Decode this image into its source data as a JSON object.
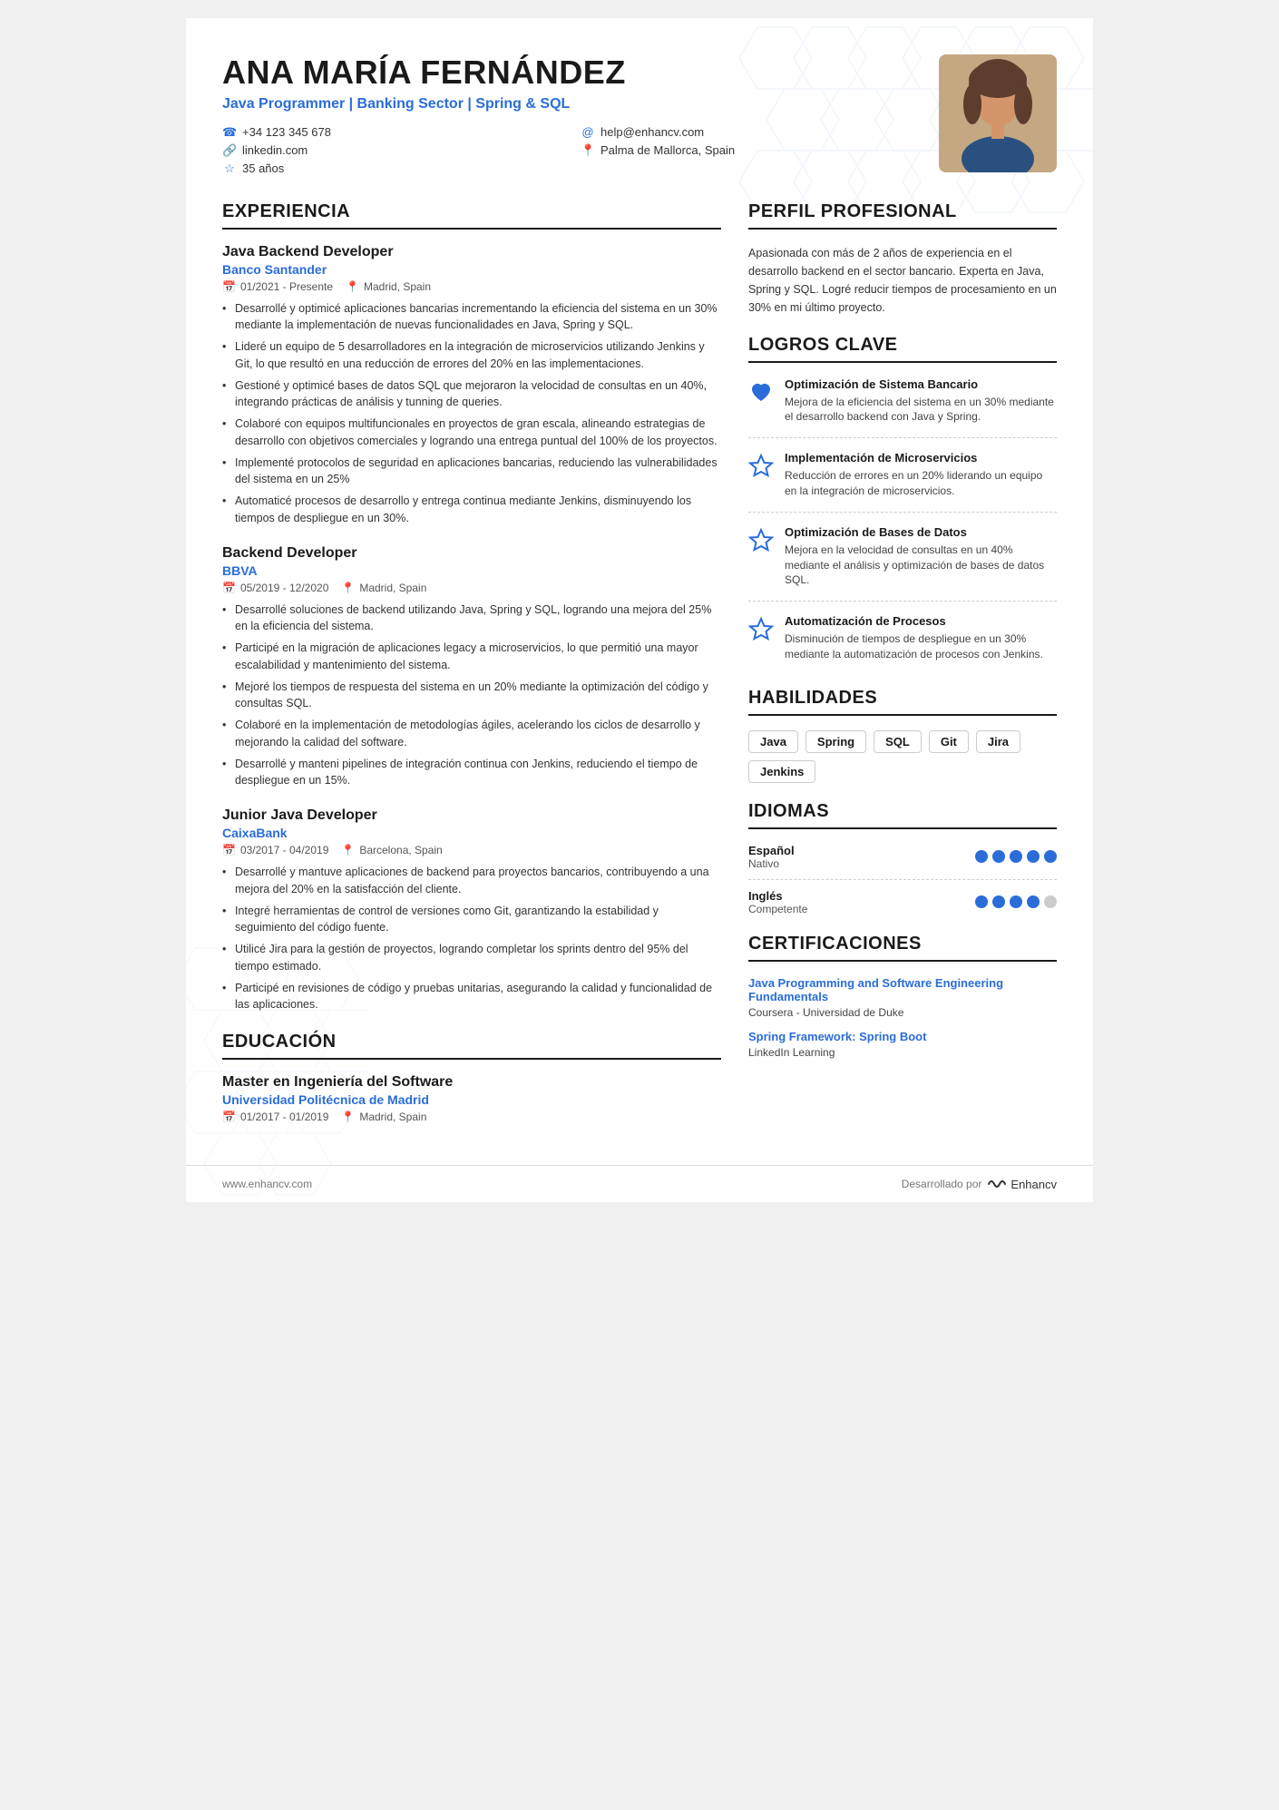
{
  "header": {
    "name": "ANA MARÍA FERNÁNDEZ",
    "title": "Java Programmer | Banking Sector | Spring & SQL",
    "contacts": [
      {
        "icon": "📞",
        "text": "+34 123 345 678",
        "type": "phone"
      },
      {
        "icon": "✉",
        "text": "help@enhancv.com",
        "type": "email"
      },
      {
        "icon": "🔗",
        "text": "linkedin.com",
        "type": "linkedin"
      },
      {
        "icon": "📍",
        "text": "Palma de Mallorca, Spain",
        "type": "location"
      },
      {
        "icon": "⭐",
        "text": "35 años",
        "type": "age"
      }
    ]
  },
  "experiencia": {
    "section_title": "EXPERIENCIA",
    "jobs": [
      {
        "title": "Java Backend Developer",
        "company": "Banco Santander",
        "date": "01/2021 - Presente",
        "location": "Madrid, Spain",
        "bullets": [
          "Desarrollé y optimicé aplicaciones bancarias incrementando la eficiencia del sistema en un 30% mediante la implementación de nuevas funcionalidades en Java, Spring y SQL.",
          "Lideré un equipo de 5 desarrolladores en la integración de microservicios utilizando Jenkins y Git, lo que resultó en una reducción de errores del 20% en las implementaciones.",
          "Gestioné y optimicé bases de datos SQL que mejoraron la velocidad de consultas en un 40%, integrando prácticas de análisis y tunning de queries.",
          "Colaboré con equipos multifuncionales en proyectos de gran escala, alineando estrategias de desarrollo con objetivos comerciales y logrando una entrega puntual del 100% de los proyectos.",
          "Implementé protocolos de seguridad en aplicaciones bancarias, reduciendo las vulnerabilidades del sistema en un 25%",
          "Automaticé procesos de desarrollo y entrega continua mediante Jenkins, disminuyendo los tiempos de despliegue en un 30%."
        ]
      },
      {
        "title": "Backend Developer",
        "company": "BBVA",
        "date": "05/2019 - 12/2020",
        "location": "Madrid, Spain",
        "bullets": [
          "Desarrollé soluciones de backend utilizando Java, Spring y SQL, logrando una mejora del 25% en la eficiencia del sistema.",
          "Participé en la migración de aplicaciones legacy a microservicios, lo que permitió una mayor escalabilidad y mantenimiento del sistema.",
          "Mejoré los tiempos de respuesta del sistema en un 20% mediante la optimización del código y consultas SQL.",
          "Colaboré en la implementación de metodologías ágiles, acelerando los ciclos de desarrollo y mejorando la calidad del software.",
          "Desarrollé y manteni pipelines de integración continua con Jenkins, reduciendo el tiempo de despliegue en un 15%."
        ]
      },
      {
        "title": "Junior Java Developer",
        "company": "CaixaBank",
        "date": "03/2017 - 04/2019",
        "location": "Barcelona, Spain",
        "bullets": [
          "Desarrollé y mantuve aplicaciones de backend para proyectos bancarios, contribuyendo a una mejora del 20% en la satisfacción del cliente.",
          "Integré herramientas de control de versiones como Git, garantizando la estabilidad y seguimiento del código fuente.",
          "Utilicé Jira para la gestión de proyectos, logrando completar los sprints dentro del 95% del tiempo estimado.",
          "Participé en revisiones de código y pruebas unitarias, asegurando la calidad y funcionalidad de las aplicaciones."
        ]
      }
    ]
  },
  "educacion": {
    "section_title": "EDUCACIÓN",
    "items": [
      {
        "degree": "Master en Ingeniería del Software",
        "school": "Universidad Politécnica de Madrid",
        "date": "01/2017 - 01/2019",
        "location": "Madrid, Spain"
      }
    ]
  },
  "perfil": {
    "section_title": "PERFIL PROFESIONAL",
    "text": "Apasionada con más de 2 años de experiencia en el desarrollo backend en el sector bancario. Experta en Java, Spring y SQL. Logré reducir tiempos de procesamiento en un 30% en mi último proyecto."
  },
  "logros": {
    "section_title": "LOGROS CLAVE",
    "items": [
      {
        "icon": "heart",
        "title": "Optimización de Sistema Bancario",
        "desc": "Mejora de la eficiencia del sistema en un 30% mediante el desarrollo backend con Java y Spring.",
        "filled": true
      },
      {
        "icon": "star",
        "title": "Implementación de Microservicios",
        "desc": "Reducción de errores en un 20% liderando un equipo en la integración de microservicios.",
        "filled": false
      },
      {
        "icon": "star",
        "title": "Optimización de Bases de Datos",
        "desc": "Mejora en la velocidad de consultas en un 40% mediante el análisis y optimización de bases de datos SQL.",
        "filled": false
      },
      {
        "icon": "star",
        "title": "Automatización de Procesos",
        "desc": "Disminución de tiempos de despliegue en un 30% mediante la automatización de procesos con Jenkins.",
        "filled": false
      }
    ]
  },
  "habilidades": {
    "section_title": "HABILIDADES",
    "skills": [
      "Java",
      "Spring",
      "SQL",
      "Git",
      "Jira",
      "Jenkins"
    ]
  },
  "idiomas": {
    "section_title": "IDIOMAS",
    "items": [
      {
        "name": "Español",
        "level": "Nativo",
        "dots": 5,
        "filled": 5
      },
      {
        "name": "Inglés",
        "level": "Competente",
        "dots": 5,
        "filled": 4
      }
    ]
  },
  "certificaciones": {
    "section_title": "CERTIFICACIONES",
    "items": [
      {
        "name": "Java Programming and Software Engineering Fundamentals",
        "provider": "Coursera - Universidad de Duke"
      },
      {
        "name": "Spring Framework: Spring Boot",
        "provider": "LinkedIn Learning"
      }
    ]
  },
  "footer": {
    "website": "www.enhancv.com",
    "developed_by": "Desarrollado por",
    "brand": "Enhancv"
  }
}
